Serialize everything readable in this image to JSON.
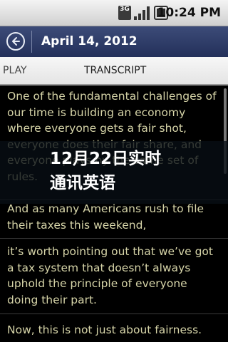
{
  "status_bar": {
    "network_label": "3G",
    "time": "10:24 PM",
    "icons": [
      "network-3g-icon",
      "signal-icon",
      "battery-icon"
    ]
  },
  "header": {
    "title": "April 14, 2012",
    "back_icon": "back-arrow-icon"
  },
  "tabs": [
    {
      "label": "PLAY"
    },
    {
      "label": "TRANSCRIPT"
    }
  ],
  "transcript": [
    "One of the fundamental challenges of our time is building an economy where everyone gets a fair shot, everyone does their fair share, and everyone plays by the same set of rules.",
    "And as many Americans rush to file their taxes this weekend,",
    "it’s worth pointing out that we’ve got a tax system that doesn’t always uphold the principle of everyone doing their part.",
    "Now, this is not just about fairness."
  ],
  "overlay": {
    "text": "12月22日实时通讯英语"
  },
  "colors": {
    "title_bar": "#2c3a66",
    "text": "#d6d4a8",
    "background": "#000000"
  }
}
